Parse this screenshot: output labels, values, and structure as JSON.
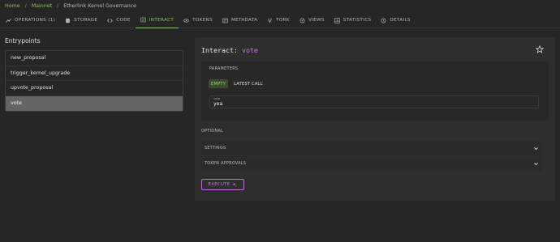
{
  "breadcrumb": {
    "home": "Home",
    "network": "Mainnet",
    "current": "Etherlink Kernel Governance"
  },
  "tabs": [
    {
      "label": "OPERATIONS (1)",
      "icon": "operations-icon"
    },
    {
      "label": "STORAGE",
      "icon": "storage-icon"
    },
    {
      "label": "CODE",
      "icon": "code-icon"
    },
    {
      "label": "INTERACT",
      "icon": "interact-icon"
    },
    {
      "label": "TOKENS",
      "icon": "tokens-icon"
    },
    {
      "label": "METADATA",
      "icon": "metadata-icon"
    },
    {
      "label": "FORK",
      "icon": "fork-icon"
    },
    {
      "label": "VIEWS",
      "icon": "views-icon"
    },
    {
      "label": "STATISTICS",
      "icon": "statistics-icon"
    },
    {
      "label": "DETAILS",
      "icon": "details-icon"
    }
  ],
  "active_tab": "INTERACT",
  "entrypoints": {
    "title": "Entrypoints",
    "items": [
      "new_proposal",
      "trigger_kernel_upgrade",
      "upvote_proposal",
      "vote"
    ],
    "selected": "vote"
  },
  "interact": {
    "header_prefix": "Interact:",
    "entrypoint": "vote",
    "parameters_label": "PARAMETERS",
    "toggle": {
      "empty": "EMPTY",
      "latest": "LATEST CALL"
    },
    "field": {
      "label": "vote",
      "value": "yea"
    },
    "optional_label": "OPTIONAL",
    "settings_label": "SETTINGS",
    "token_approvals_label": "TOKEN APPROVALS",
    "execute_label": "EXECUTE"
  },
  "colors": {
    "accent_green": "#8fbf6a",
    "accent_purple": "#c77be0",
    "background": "#262626",
    "panel": "#2e2e2e"
  }
}
